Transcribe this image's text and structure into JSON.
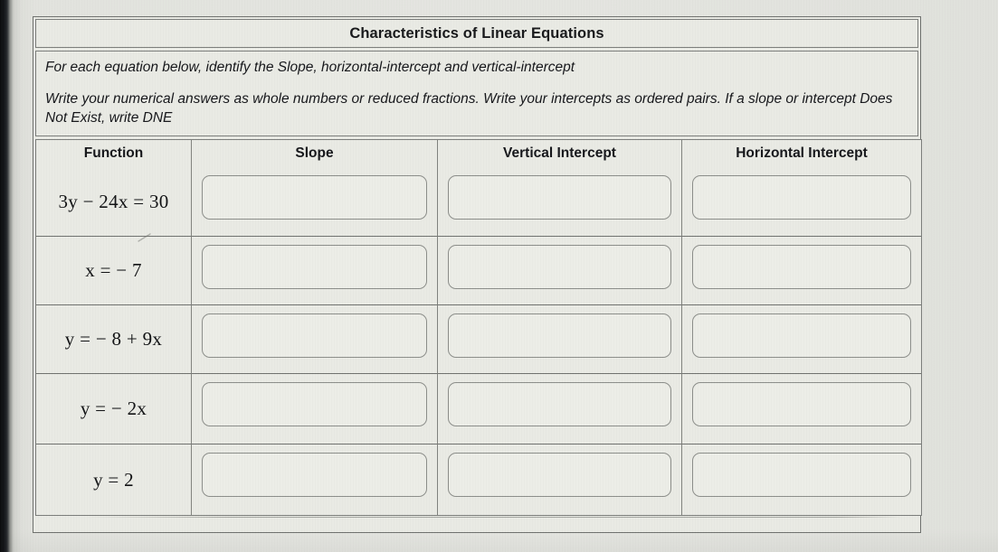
{
  "worksheet": {
    "title": "Characteristics of Linear Equations",
    "instructions": {
      "line1": "For each equation below, identify the Slope, horizontal-intercept and vertical-intercept",
      "line2": "Write your numerical answers as whole numbers or reduced fractions. Write your intercepts as ordered pairs. If a slope or intercept Does Not Exist, write DNE"
    },
    "table": {
      "headers": [
        "Function",
        "Slope",
        "Vertical Intercept",
        "Horizontal Intercept"
      ],
      "rows": [
        {
          "function": "3y − 24x = 30",
          "slope": "",
          "vertical_intercept": "",
          "horizontal_intercept": ""
        },
        {
          "function": "x = − 7",
          "slope": "",
          "vertical_intercept": "",
          "horizontal_intercept": ""
        },
        {
          "function": "y = − 8 + 9x",
          "slope": "",
          "vertical_intercept": "",
          "horizontal_intercept": ""
        },
        {
          "function": "y = − 2x",
          "slope": "",
          "vertical_intercept": "",
          "horizontal_intercept": ""
        },
        {
          "function": "y = 2",
          "slope": "",
          "vertical_intercept": "",
          "horizontal_intercept": ""
        }
      ]
    },
    "input_placeholder": ""
  },
  "colors": {
    "page_background": "#e4e5e0",
    "table_background": "#e9eae4",
    "border": "#7b7d7a",
    "text": "#15161a",
    "input_border": "#8c8e8a"
  }
}
